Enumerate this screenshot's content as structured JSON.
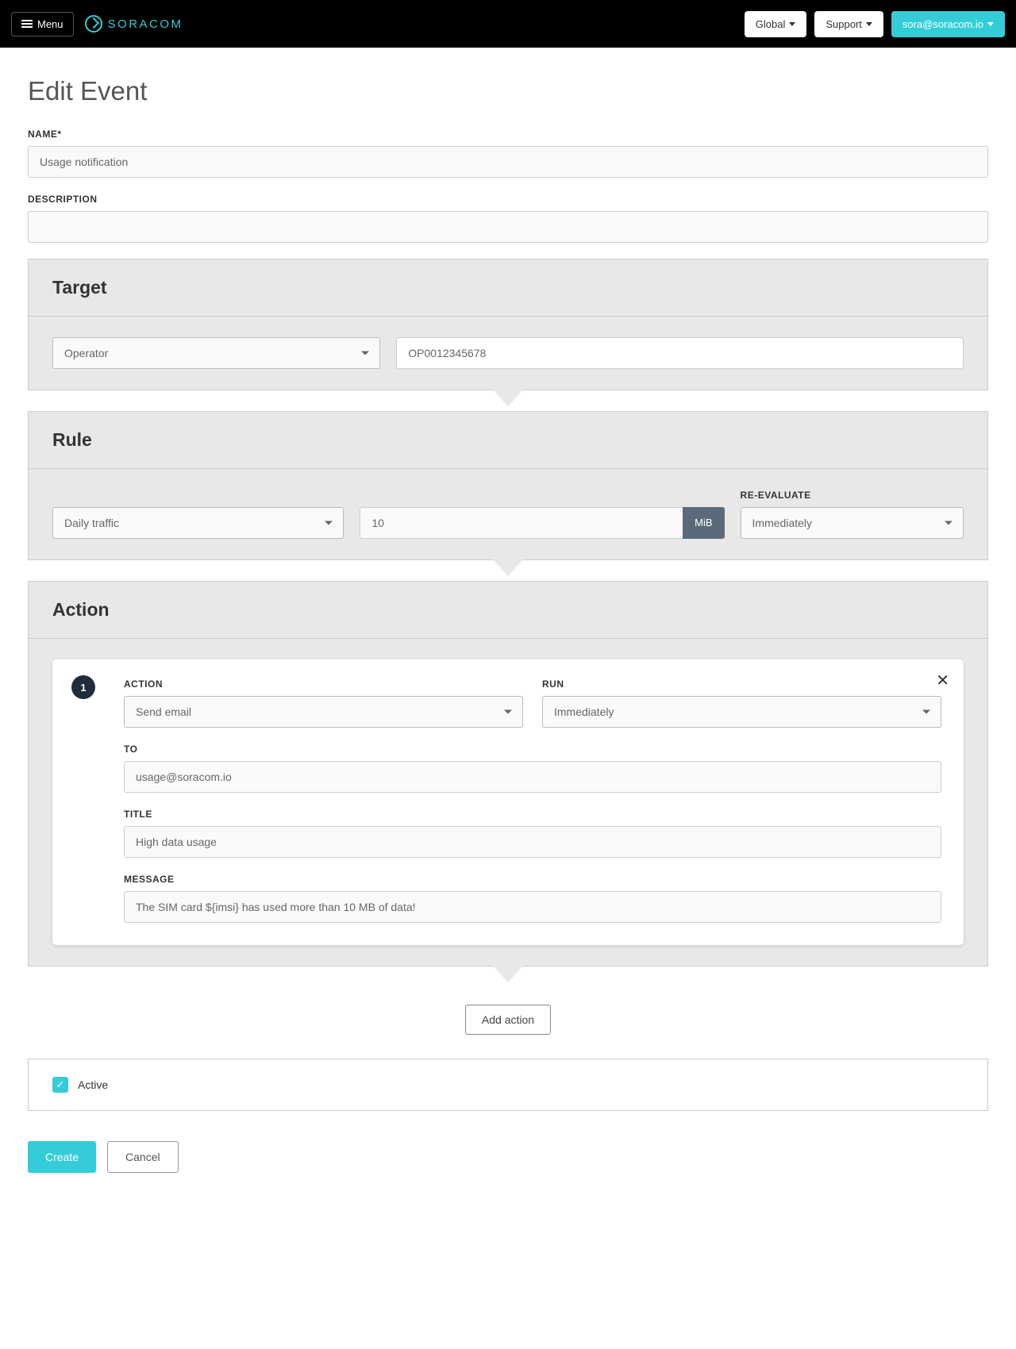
{
  "nav": {
    "menu": "Menu",
    "brand": "SORACOM",
    "global": "Global",
    "support": "Support",
    "user": "sora@soracom.io"
  },
  "page": {
    "title": "Edit Event",
    "name_label": "NAME*",
    "name_value": "Usage notification",
    "desc_label": "DESCRIPTION",
    "desc_value": ""
  },
  "target": {
    "heading": "Target",
    "type": "Operator",
    "id": "OP0012345678"
  },
  "rule": {
    "heading": "Rule",
    "type": "Daily traffic",
    "value": "10",
    "unit": "MiB",
    "reeval_label": "RE-EVALUATE",
    "reeval_value": "Immediately"
  },
  "action": {
    "heading": "Action",
    "number": "1",
    "action_label": "ACTION",
    "action_value": "Send email",
    "run_label": "RUN",
    "run_value": "Immediately",
    "to_label": "TO",
    "to_value": "usage@soracom.io",
    "title_label": "TITLE",
    "title_value": "High data usage",
    "message_label": "MESSAGE",
    "message_value": "The SIM card ${imsi} has used more than 10 MB of data!",
    "add_action": "Add action"
  },
  "status": {
    "active_label": "Active"
  },
  "buttons": {
    "create": "Create",
    "cancel": "Cancel"
  }
}
